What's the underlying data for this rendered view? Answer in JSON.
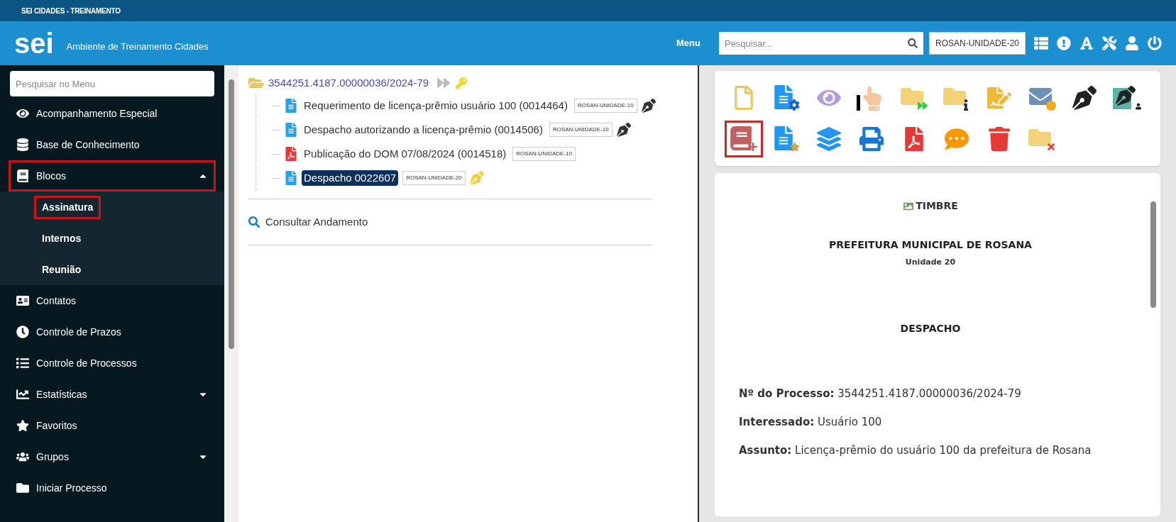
{
  "top_bar": {
    "title": "SEI CIDADES - TREINAMENTO"
  },
  "header": {
    "logo": "sei",
    "environment": "Ambiente de Treinamento Cidades",
    "menu_label": "Menu",
    "search": {
      "placeholder": "Pesquisar..."
    },
    "unit": "ROSAN-UNIDADE-20"
  },
  "sidebar": {
    "search": {
      "placeholder": "Pesquisar no Menu"
    },
    "items": [
      {
        "kind": "eye",
        "label": "Acompanhamento Especial",
        "highlighted": false
      },
      {
        "kind": "database",
        "label": "Base de Conhecimento",
        "highlighted": false
      },
      {
        "kind": "book",
        "label": "Blocos",
        "highlighted": true,
        "expanded": true,
        "children": [
          {
            "label": "Assinatura",
            "highlighted": true
          },
          {
            "label": "Internos",
            "highlighted": false
          },
          {
            "label": "Reunião",
            "highlighted": false
          }
        ]
      },
      {
        "kind": "card",
        "label": "Contatos",
        "highlighted": false
      },
      {
        "kind": "clock",
        "label": "Controle de Prazos",
        "highlighted": false
      },
      {
        "kind": "list",
        "label": "Controle de Processos",
        "highlighted": false
      },
      {
        "kind": "chart",
        "label": "Estatísticas",
        "highlighted": false,
        "expanded": false
      },
      {
        "kind": "star",
        "label": "Favoritos",
        "highlighted": false
      },
      {
        "kind": "users",
        "label": "Grupos",
        "highlighted": false,
        "expanded": false
      },
      {
        "kind": "folder",
        "label": "Iniciar Processo",
        "highlighted": false
      }
    ]
  },
  "tree": {
    "process": "3544251.4187.00000036/2024-79",
    "documents": [
      {
        "kind": "doc",
        "label": "Requerimento de licença-prêmio usuário 100 (0014464)",
        "unit": "ROSAN-UNIDADE-10",
        "signed": true,
        "editing": false,
        "selected": false
      },
      {
        "kind": "doc",
        "label": "Despacho autorizando a licença-prêmio (0014506)",
        "unit": "ROSAN-UNIDADE-10",
        "signed": true,
        "editing": false,
        "selected": false
      },
      {
        "kind": "pdf",
        "label": "Publicação do DOM 07/08/2024 (0014518)",
        "unit": "ROSAN-UNIDADE-10",
        "signed": false,
        "editing": false,
        "selected": false
      },
      {
        "kind": "doc",
        "label": "Despacho 0022607",
        "unit": "ROSAN-UNIDADE-20",
        "signed": false,
        "editing": true,
        "selected": true
      }
    ],
    "action": "Consultar Andamento"
  },
  "toolbar_buttons": [
    {
      "highlighted": false
    },
    {
      "highlighted": false
    },
    {
      "highlighted": false
    },
    {
      "highlighted": false
    },
    {
      "highlighted": false
    },
    {
      "highlighted": false
    },
    {
      "highlighted": false
    },
    {
      "highlighted": false
    },
    {
      "highlighted": false
    },
    {
      "highlighted": false
    },
    {
      "highlighted": true
    },
    {
      "highlighted": false
    },
    {
      "highlighted": false
    },
    {
      "highlighted": false
    },
    {
      "highlighted": false
    },
    {
      "highlighted": false
    },
    {
      "highlighted": false
    },
    {
      "highlighted": false
    }
  ],
  "document": {
    "letterhead": "TIMBRE",
    "org": "PREFEITURA MUNICIPAL DE ROSANA",
    "unit": "Unidade 20",
    "title": "DESPACHO",
    "fields": [
      "**Nº do Processo:** 3544251.4187.00000036/2024-79",
      "**Interessado:** Usuário 100",
      "**Assunto:** Licença-prêmio do usuário 100 da prefeitura de Rosana"
    ]
  }
}
